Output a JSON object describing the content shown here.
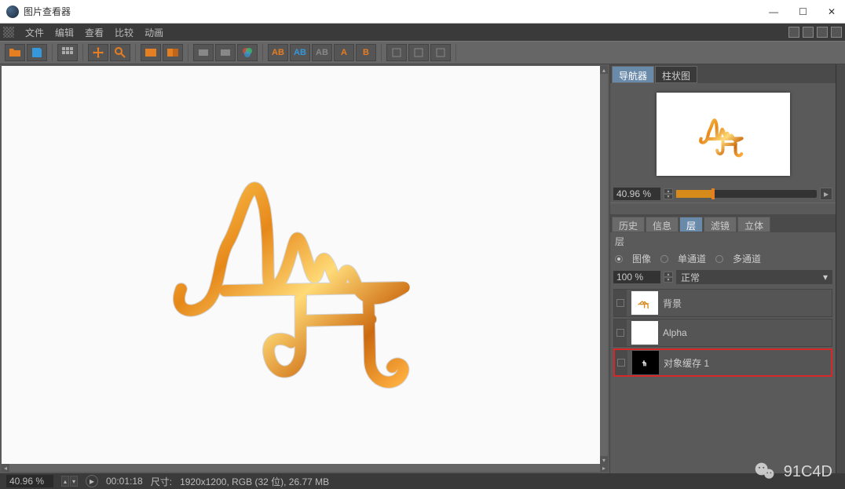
{
  "window": {
    "title": "图片查看器"
  },
  "menu": {
    "file": "文件",
    "edit": "编辑",
    "view": "查看",
    "compare": "比较",
    "animation": "动画"
  },
  "sidepanel": {
    "nav_tab": "导航器",
    "histogram_tab": "柱状图",
    "zoom_value": "40.96 %",
    "history_tab": "历史",
    "info_tab": "信息",
    "layer_tab": "层",
    "filter_tab": "滤镜",
    "stereo_tab": "立体",
    "layer_header": "层",
    "radio_image": "图像",
    "radio_single": "单通道",
    "radio_multi": "多通道",
    "opacity_value": "100 %",
    "blend_mode": "正常",
    "layers": [
      {
        "name": "背景"
      },
      {
        "name": "Alpha"
      },
      {
        "name": "对象缓存 1"
      }
    ]
  },
  "statusbar": {
    "zoom": "40.96 %",
    "time": "00:01:18",
    "dimensions_label": "尺寸:",
    "info": "1920x1200, RGB (32 位), 26.77 MB"
  },
  "watermark": {
    "text": "91C4D"
  }
}
